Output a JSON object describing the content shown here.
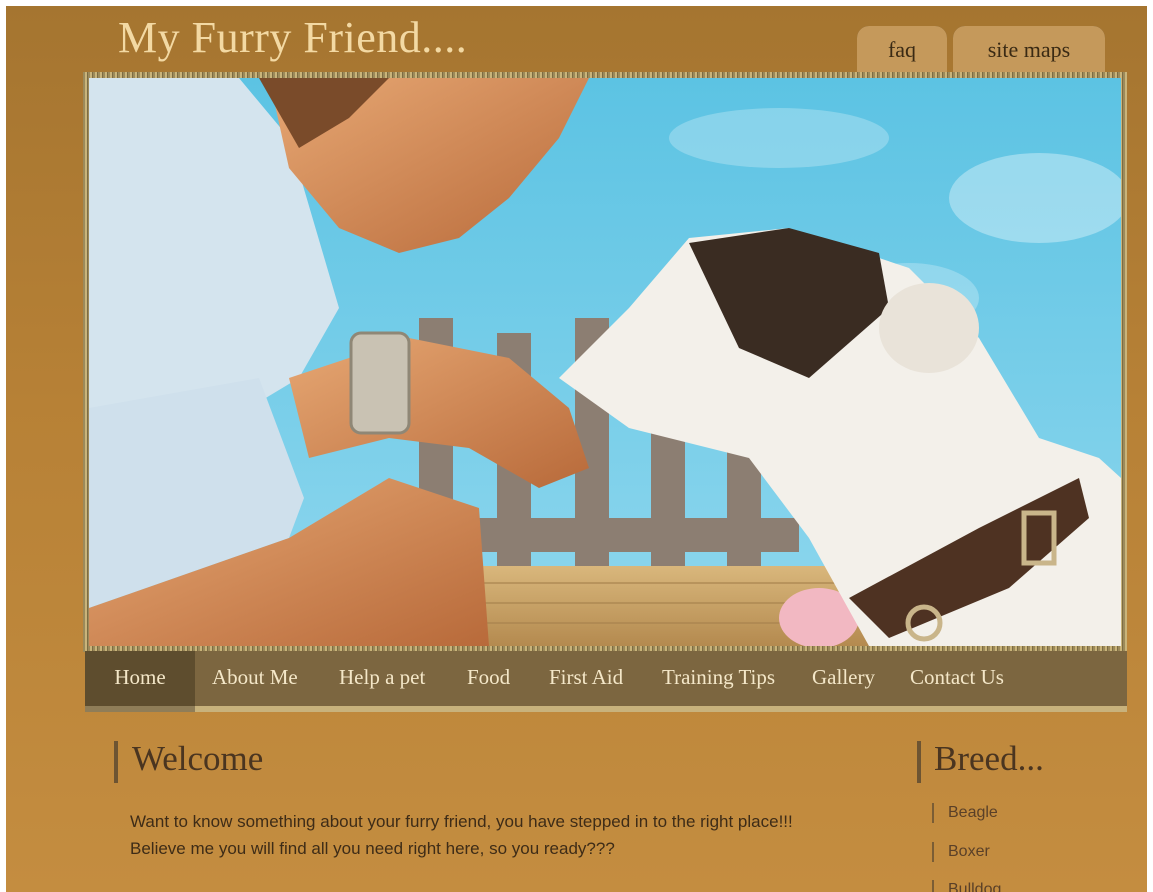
{
  "header": {
    "site_title": "My Furry Friend....",
    "top_tabs": [
      "faq",
      "site maps"
    ]
  },
  "nav": {
    "items": [
      "Home",
      "About Me",
      "Help a pet",
      "Food",
      "First Aid",
      "Training Tips",
      "Gallery",
      "Contact Us"
    ],
    "active": "Home"
  },
  "welcome": {
    "title": "Welcome",
    "lines": [
      "Want to know something about your furry friend, you have stepped in to the right place!!!",
      "Believe me you will find all you need right here, so you ready???"
    ]
  },
  "breed": {
    "title": "Breed...",
    "items": [
      "Beagle",
      "Boxer",
      "Bulldog"
    ]
  },
  "colors": {
    "page_background": "#b78136",
    "nav_background": "#7c6640",
    "title_color": "#f3d9a3"
  }
}
